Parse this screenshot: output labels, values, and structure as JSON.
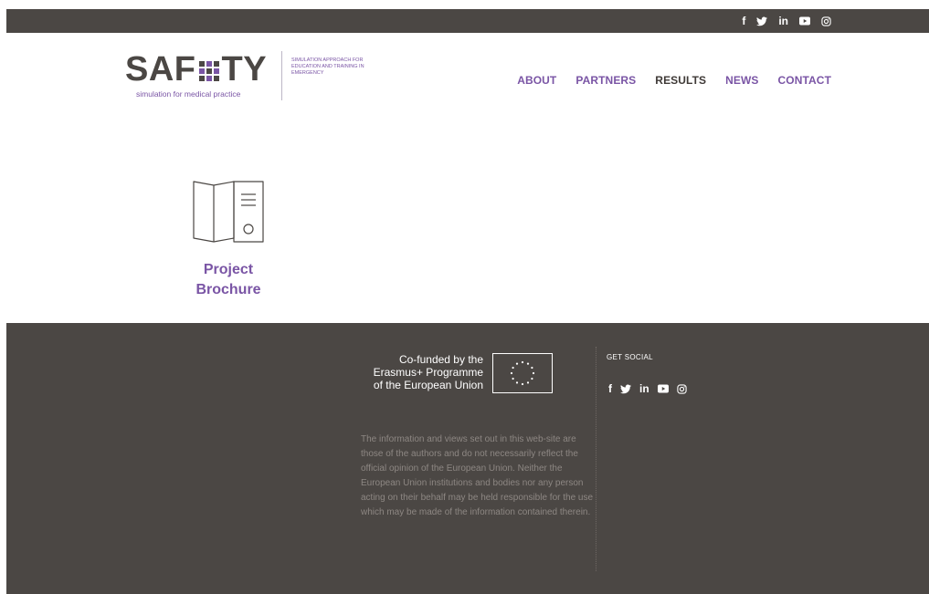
{
  "social_icons": [
    "facebook-icon",
    "twitter-icon",
    "linkedin-icon",
    "youtube-icon",
    "instagram-icon"
  ],
  "top_social": {
    "facebook": "f",
    "linkedin": "in"
  },
  "logo": {
    "letters_left": "SAF",
    "letters_right": "TY",
    "subtitle": "simulation for medical practice",
    "tagline": "SIMULATION APPROACH FOR EDUCATION AND TRAINING IN EMERGENCY"
  },
  "nav": {
    "about": "ABOUT",
    "partners": "PARTNERS",
    "results": "RESULTS",
    "news": "NEWS",
    "contact": "CONTACT"
  },
  "brochure": {
    "line1": "Project",
    "line2": "Brochure"
  },
  "footer": {
    "cofund_line1": "Co-funded by the",
    "cofund_line2": "Erasmus+ Programme",
    "cofund_line3": "of the European Union",
    "disclaimer": "The information and views set out in this web-site are those of the authors and do not necessarily reflect the official opinion of the European Union. Neither the European Union institutions and bodies nor any person acting on their behalf may be held responsible for the use which may be made of the information contained therein.",
    "get_social": "GET SOCIAL",
    "facebook": "f",
    "linkedin": "in"
  },
  "colors": {
    "brand_purple": "#7a55a5",
    "dark_gray": "#4b4744",
    "nav_active": "#3f3a37"
  }
}
